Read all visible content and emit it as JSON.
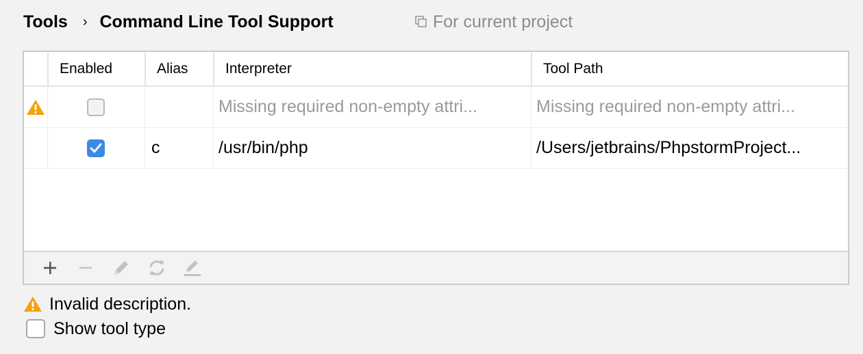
{
  "breadcrumb": {
    "parent": "Tools",
    "separator": "›",
    "current": "Command Line Tool Support"
  },
  "scope": {
    "icon": "copy-icon",
    "label": "For current project"
  },
  "table": {
    "columns": [
      "Enabled",
      "Alias",
      "Interpreter",
      "Tool Path"
    ],
    "rows": [
      {
        "warning": true,
        "enabled": false,
        "alias": "",
        "interpreter": "Missing required non-empty attri...",
        "tool_path": "Missing required non-empty attri..."
      },
      {
        "warning": false,
        "enabled": true,
        "alias": "c",
        "interpreter": "/usr/bin/php",
        "tool_path": "/Users/jetbrains/PhpstormProject..."
      }
    ]
  },
  "toolbar": {
    "add": "+",
    "remove": "−",
    "buttons": [
      "add-icon",
      "remove-icon",
      "edit-icon",
      "refresh-icon",
      "rename-icon"
    ]
  },
  "status": {
    "message": "Invalid description."
  },
  "options": {
    "show_tool_type_label": "Show tool type",
    "show_tool_type_checked": false
  },
  "colors": {
    "accent": "#3d89e6",
    "warning": "#f0a30a",
    "muted_text": "#9a9a9a"
  }
}
